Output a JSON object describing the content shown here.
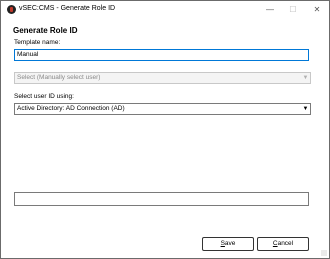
{
  "window": {
    "title": "vSEC:CMS - Generate Role ID",
    "min_glyph": "—",
    "max_glyph": "☐",
    "close_glyph": "✕"
  },
  "form": {
    "heading": "Generate Role ID",
    "template_name_label": "Template name:",
    "template_name_value": "Manual",
    "user_select_placeholder": "Select (Manually select user)",
    "select_user_id_label": "Select user ID using:",
    "select_user_id_value": "Active Directory: AD Connection (AD)",
    "dropdown_glyph": "▼"
  },
  "buttons": {
    "save_mnemonic": "S",
    "save_rest": "ave",
    "cancel_mnemonic": "C",
    "cancel_rest": "ancel"
  },
  "icons": {
    "app": "vsec-app-icon",
    "minimize": "minimize-icon",
    "maximize": "maximize-icon",
    "close": "close-icon",
    "dropdown": "chevron-down-icon"
  },
  "colors": {
    "focus_border": "#0078d7",
    "disabled_text": "#8a8a8a"
  }
}
